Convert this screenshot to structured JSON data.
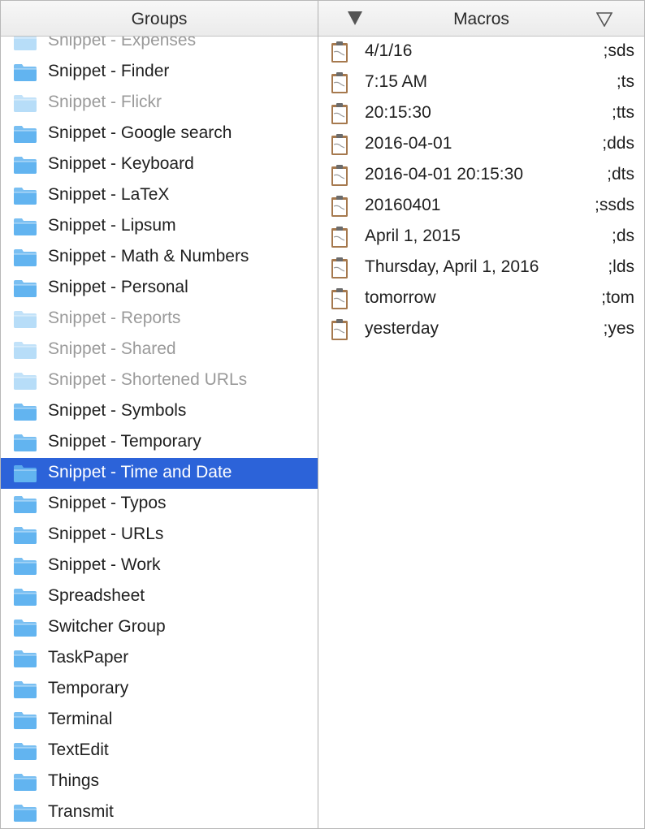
{
  "groups_header": "Groups",
  "macros_header": "Macros",
  "groups": [
    {
      "label": "Snippet - Expenses",
      "state": "dim"
    },
    {
      "label": "Snippet - Finder",
      "state": "normal"
    },
    {
      "label": "Snippet - Flickr",
      "state": "dim"
    },
    {
      "label": "Snippet - Google search",
      "state": "normal"
    },
    {
      "label": "Snippet - Keyboard",
      "state": "normal"
    },
    {
      "label": "Snippet - LaTeX",
      "state": "normal"
    },
    {
      "label": "Snippet - Lipsum",
      "state": "normal"
    },
    {
      "label": "Snippet - Math & Numbers",
      "state": "normal"
    },
    {
      "label": "Snippet - Personal",
      "state": "normal"
    },
    {
      "label": "Snippet - Reports",
      "state": "dim"
    },
    {
      "label": "Snippet - Shared",
      "state": "dim"
    },
    {
      "label": "Snippet - Shortened URLs",
      "state": "dim"
    },
    {
      "label": "Snippet - Symbols",
      "state": "normal"
    },
    {
      "label": "Snippet - Temporary",
      "state": "normal"
    },
    {
      "label": "Snippet - Time and Date",
      "state": "selected"
    },
    {
      "label": "Snippet - Typos",
      "state": "normal"
    },
    {
      "label": "Snippet - URLs",
      "state": "normal"
    },
    {
      "label": "Snippet - Work",
      "state": "normal"
    },
    {
      "label": "Spreadsheet",
      "state": "normal"
    },
    {
      "label": "Switcher Group",
      "state": "normal"
    },
    {
      "label": "TaskPaper",
      "state": "normal"
    },
    {
      "label": "Temporary",
      "state": "normal"
    },
    {
      "label": "Terminal",
      "state": "normal"
    },
    {
      "label": "TextEdit",
      "state": "normal"
    },
    {
      "label": "Things",
      "state": "normal"
    },
    {
      "label": "Transmit",
      "state": "normal"
    }
  ],
  "macros": [
    {
      "name": "4/1/16",
      "abbr": ";sds"
    },
    {
      "name": "7:15 AM",
      "abbr": ";ts"
    },
    {
      "name": "20:15:30",
      "abbr": ";tts"
    },
    {
      "name": "2016-04-01",
      "abbr": ";dds"
    },
    {
      "name": "2016-04-01 20:15:30",
      "abbr": ";dts"
    },
    {
      "name": "20160401",
      "abbr": ";ssds"
    },
    {
      "name": "April 1, 2015",
      "abbr": ";ds"
    },
    {
      "name": "Thursday, April 1, 2016",
      "abbr": ";lds"
    },
    {
      "name": "tomorrow",
      "abbr": ";tom"
    },
    {
      "name": "yesterday",
      "abbr": ";yes"
    }
  ],
  "icons": {
    "folder": "folder-icon",
    "macro": "clipboard-icon",
    "sort_active": "sort-descending-icon",
    "sort_inactive": "sort-toggle-icon"
  },
  "colors": {
    "selection": "#2c63d9",
    "folder": "#62b4f0",
    "dim_text": "#9a9a9a"
  }
}
